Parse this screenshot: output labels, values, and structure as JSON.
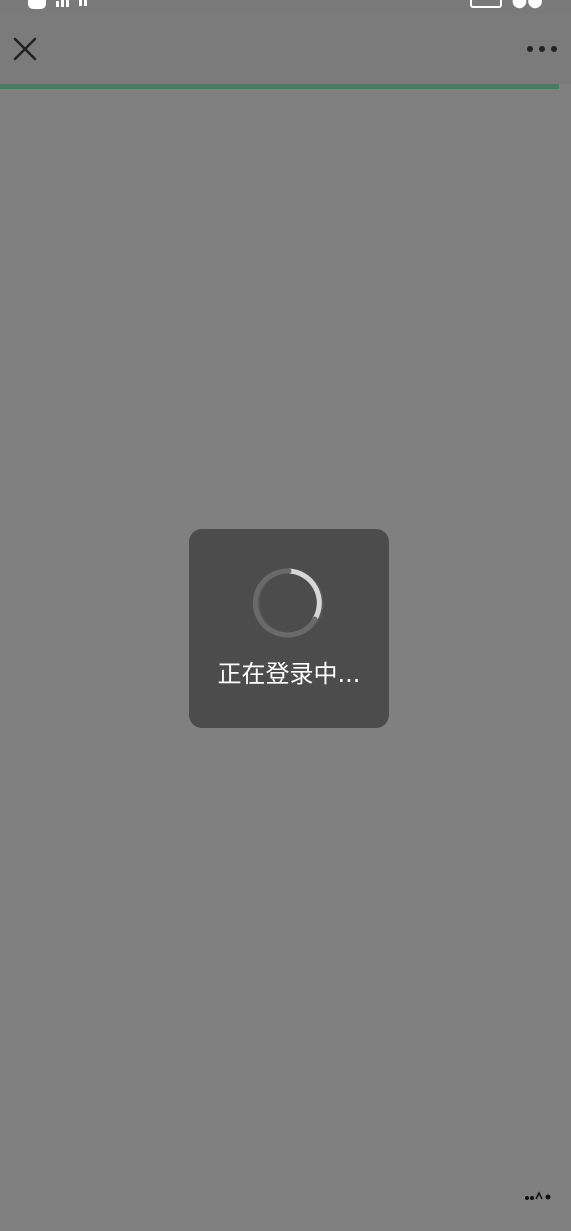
{
  "loading": {
    "message": "正在登录中..."
  },
  "colors": {
    "background": "#808080",
    "toast": "#4c4c4c",
    "progress": "#4a7a5f",
    "text": "#ffffff"
  },
  "icons": {
    "close": "close-icon",
    "more": "more-icon",
    "spinner": "loading-spinner-icon"
  }
}
